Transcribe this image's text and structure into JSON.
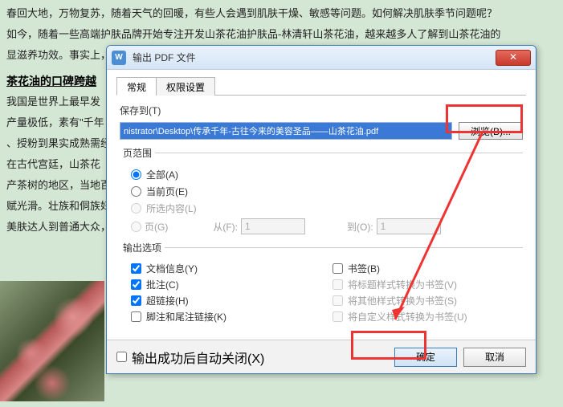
{
  "background": {
    "lines": [
      "春回大地，万物复苏，随着天气的回暖，有些人会遇到肌肤干燥、敏感等问题。如何解决肌肤季节问题呢？",
      "如今，随着一些高端护肤品牌开始专注开发山茶花油护肤品-林清轩山茶花油，越来越多人了解到山茶花油的",
      "显滋养功效。事实上，"
    ],
    "heading": "茶花油的口碑跨越",
    "side_lines": [
      "我国是世界上最早发",
      "产量极低，素有\"千年",
      "、授粉到果实成熟需经",
      "在古代宫廷，山茶花",
      "产茶树的地区，当地百",
      "赋光滑。壮族和侗族妇",
      "美肤达人到普通大众，"
    ]
  },
  "dialog": {
    "title": "输出 PDF 文件",
    "app_icon": "W",
    "close": "✕",
    "tabs": {
      "general": "常规",
      "permissions": "权限设置"
    },
    "save_to_label": "保存到(T)",
    "path_value": "nistrator\\Desktop\\传承千年-古往今来的美容圣品——山茶花油.pdf",
    "browse": "浏览(B)...",
    "range": {
      "title": "页范围",
      "all": "全部(A)",
      "current": "当前页(E)",
      "selection": "所选内容(L)",
      "pages": "页(G)",
      "from_label": "从(F):",
      "to_label": "到(O):",
      "from_value": "1",
      "to_value": "1"
    },
    "output": {
      "title": "输出选项",
      "doc_info": "文档信息(Y)",
      "comments": "批注(C)",
      "hyperlinks": "超链接(H)",
      "footnotes": "脚注和尾注链接(K)",
      "bookmarks": "书签(B)",
      "heading_to_bm": "将标题样式转换为书签(V)",
      "other_to_bm": "将其他样式转换为书签(S)",
      "custom_to_bm": "将自定义样式转换为书签(U)"
    },
    "auto_close": "输出成功后自动关闭(X)",
    "ok": "确定",
    "cancel": "取消"
  }
}
